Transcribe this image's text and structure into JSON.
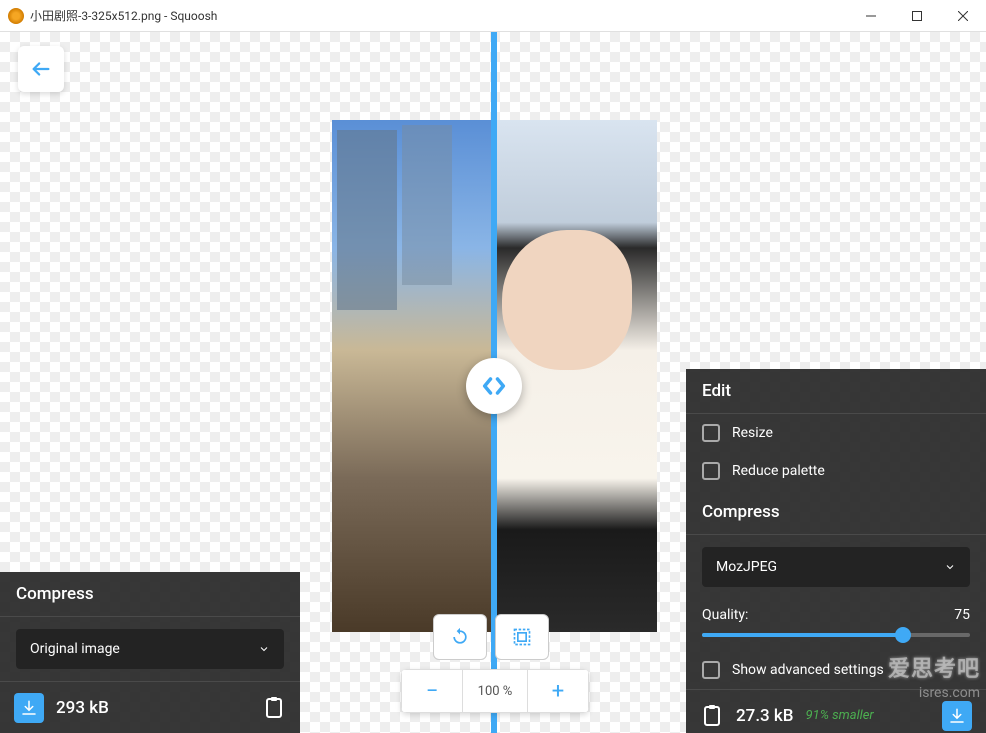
{
  "window": {
    "title": "小田剧照-3-325x512.png - Squoosh"
  },
  "zoom": {
    "value": "100 %"
  },
  "left_panel": {
    "compress_title": "Compress",
    "codec_label": "Original image",
    "size": "293 kB"
  },
  "right_panel": {
    "edit_title": "Edit",
    "resize_label": "Resize",
    "reduce_label": "Reduce palette",
    "compress_title": "Compress",
    "codec_label": "MozJPEG",
    "quality_label": "Quality:",
    "quality_value": "75",
    "advanced_label": "Show advanced settings",
    "size": "27.3 kB",
    "savings": "91% smaller"
  }
}
